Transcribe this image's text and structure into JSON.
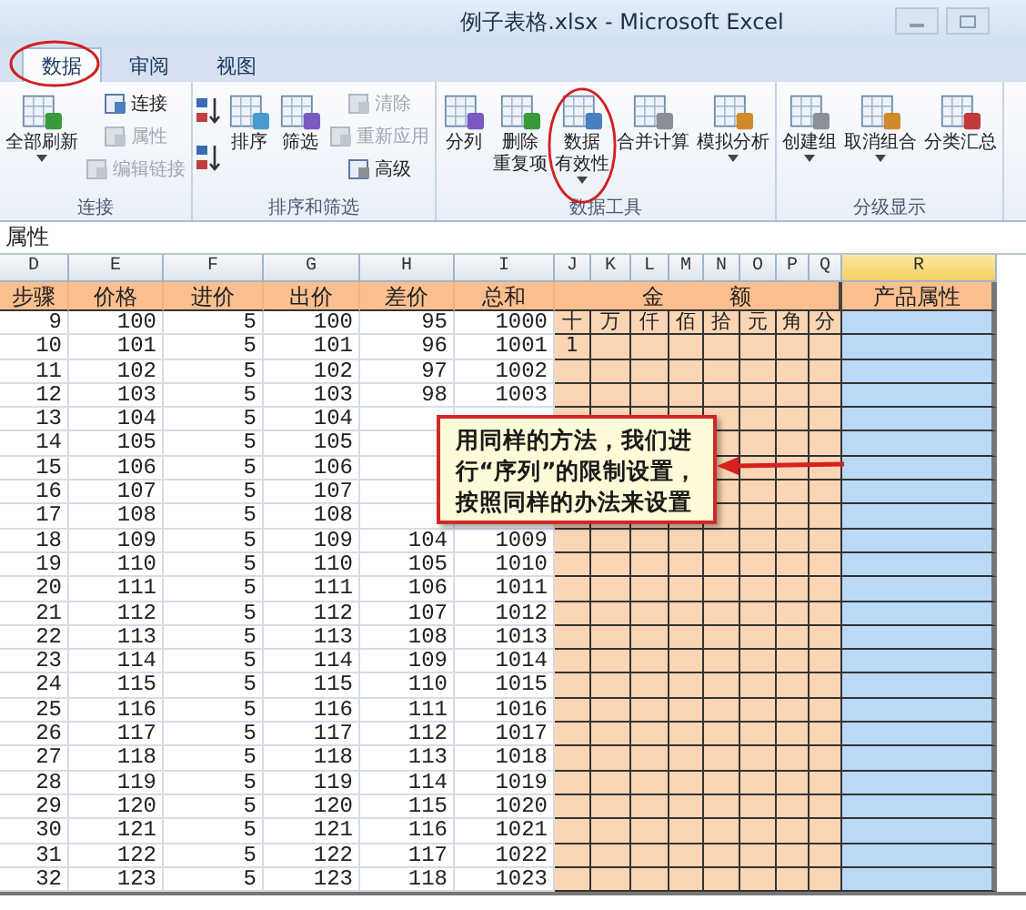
{
  "window": {
    "title": "例子表格.xlsx - Microsoft Excel"
  },
  "tabs": [
    {
      "label": "数据",
      "selected": true,
      "annotated": true
    },
    {
      "label": "审阅",
      "selected": false,
      "annotated": false
    },
    {
      "label": "视图",
      "selected": false,
      "annotated": false
    }
  ],
  "ribbon": {
    "groups": [
      {
        "label": "连接",
        "items": [
          {
            "kind": "large",
            "lines": [
              "全部刷新"
            ],
            "dropdown": true,
            "annotated": false
          },
          {
            "kind": "small",
            "label": "连接",
            "disabled": false
          },
          {
            "kind": "small",
            "label": "属性",
            "disabled": true
          },
          {
            "kind": "small",
            "label": "编辑链接",
            "disabled": true
          }
        ]
      },
      {
        "label": "排序和筛选",
        "items": [
          {
            "kind": "icon"
          },
          {
            "kind": "icon"
          },
          {
            "kind": "large",
            "lines": [
              "排序"
            ],
            "dropdown": false,
            "annotated": false
          },
          {
            "kind": "large",
            "lines": [
              "筛选"
            ],
            "dropdown": false,
            "annotated": false
          },
          {
            "kind": "small",
            "label": "清除",
            "disabled": true
          },
          {
            "kind": "small",
            "label": "重新应用",
            "disabled": true
          },
          {
            "kind": "small",
            "label": "高级",
            "disabled": false
          }
        ]
      },
      {
        "label": "数据工具",
        "items": [
          {
            "kind": "large",
            "lines": [
              "分列"
            ],
            "dropdown": false,
            "annotated": false
          },
          {
            "kind": "large",
            "lines": [
              "删除",
              "重复项"
            ],
            "dropdown": false,
            "annotated": false
          },
          {
            "kind": "large",
            "lines": [
              "数据",
              "有效性"
            ],
            "dropdown": true,
            "annotated": true
          },
          {
            "kind": "large",
            "lines": [
              "合并计算"
            ],
            "dropdown": false,
            "annotated": false
          },
          {
            "kind": "large",
            "lines": [
              "模拟分析"
            ],
            "dropdown": true,
            "annotated": false
          }
        ]
      },
      {
        "label": "分级显示",
        "items": [
          {
            "kind": "large",
            "lines": [
              "创建组"
            ],
            "dropdown": true,
            "annotated": false
          },
          {
            "kind": "large",
            "lines": [
              "取消组合"
            ],
            "dropdown": true,
            "annotated": false
          },
          {
            "kind": "large",
            "lines": [
              "分类汇总"
            ],
            "dropdown": false,
            "annotated": false
          }
        ]
      }
    ]
  },
  "formula_bar": {
    "value": "属性"
  },
  "sheet": {
    "columns": [
      {
        "label": "D",
        "selected": false
      },
      {
        "label": "E",
        "selected": false
      },
      {
        "label": "F",
        "selected": false
      },
      {
        "label": "G",
        "selected": false
      },
      {
        "label": "H",
        "selected": false
      },
      {
        "label": "I",
        "selected": false
      },
      {
        "label": "J",
        "selected": false
      },
      {
        "label": "K",
        "selected": false
      },
      {
        "label": "L",
        "selected": false
      },
      {
        "label": "M",
        "selected": false
      },
      {
        "label": "N",
        "selected": false
      },
      {
        "label": "O",
        "selected": false
      },
      {
        "label": "P",
        "selected": false
      },
      {
        "label": "Q",
        "selected": false
      },
      {
        "label": "R",
        "selected": true
      }
    ],
    "header": [
      "步骤",
      "价格",
      "进价",
      "出价",
      "差价",
      "总和"
    ],
    "amount_header": [
      "金",
      "额"
    ],
    "attribute_header": "产品属性",
    "rows": [
      {
        "cells": [
          "9",
          "100",
          "5",
          "100",
          "95",
          "1000"
        ],
        "amount": [
          "十",
          "万",
          "仟",
          "佰",
          "拾",
          "元",
          "角",
          "分"
        ]
      },
      {
        "cells": [
          "10",
          "101",
          "5",
          "101",
          "96",
          "1001"
        ],
        "amount": [
          "1"
        ]
      },
      {
        "cells": [
          "11",
          "102",
          "5",
          "102",
          "97",
          "1002"
        ]
      },
      {
        "cells": [
          "12",
          "103",
          "5",
          "103",
          "98",
          "1003"
        ]
      },
      {
        "cells": [
          "13",
          "104",
          "5",
          "104"
        ]
      },
      {
        "cells": [
          "14",
          "105",
          "5",
          "105"
        ]
      },
      {
        "cells": [
          "15",
          "106",
          "5",
          "106"
        ]
      },
      {
        "cells": [
          "16",
          "107",
          "5",
          "107"
        ]
      },
      {
        "cells": [
          "17",
          "108",
          "5",
          "108"
        ]
      },
      {
        "cells": [
          "18",
          "109",
          "5",
          "109",
          "104",
          "1009"
        ]
      },
      {
        "cells": [
          "19",
          "110",
          "5",
          "110",
          "105",
          "1010"
        ]
      },
      {
        "cells": [
          "20",
          "111",
          "5",
          "111",
          "106",
          "1011"
        ]
      },
      {
        "cells": [
          "21",
          "112",
          "5",
          "112",
          "107",
          "1012"
        ]
      },
      {
        "cells": [
          "22",
          "113",
          "5",
          "113",
          "108",
          "1013"
        ]
      },
      {
        "cells": [
          "23",
          "114",
          "5",
          "114",
          "109",
          "1014"
        ]
      },
      {
        "cells": [
          "24",
          "115",
          "5",
          "115",
          "110",
          "1015"
        ]
      },
      {
        "cells": [
          "25",
          "116",
          "5",
          "116",
          "111",
          "1016"
        ]
      },
      {
        "cells": [
          "26",
          "117",
          "5",
          "117",
          "112",
          "1017"
        ]
      },
      {
        "cells": [
          "27",
          "118",
          "5",
          "118",
          "113",
          "1018"
        ]
      },
      {
        "cells": [
          "28",
          "119",
          "5",
          "119",
          "114",
          "1019"
        ]
      },
      {
        "cells": [
          "29",
          "120",
          "5",
          "120",
          "115",
          "1020"
        ]
      },
      {
        "cells": [
          "30",
          "121",
          "5",
          "121",
          "116",
          "1021"
        ]
      },
      {
        "cells": [
          "31",
          "122",
          "5",
          "122",
          "117",
          "1022"
        ]
      },
      {
        "cells": [
          "32",
          "123",
          "5",
          "123",
          "118",
          "1023"
        ]
      }
    ]
  },
  "callout": {
    "lines": [
      "用同样的方法，我们进",
      "行“序列”的限制设置，",
      "按照同样的办法来设置"
    ]
  }
}
